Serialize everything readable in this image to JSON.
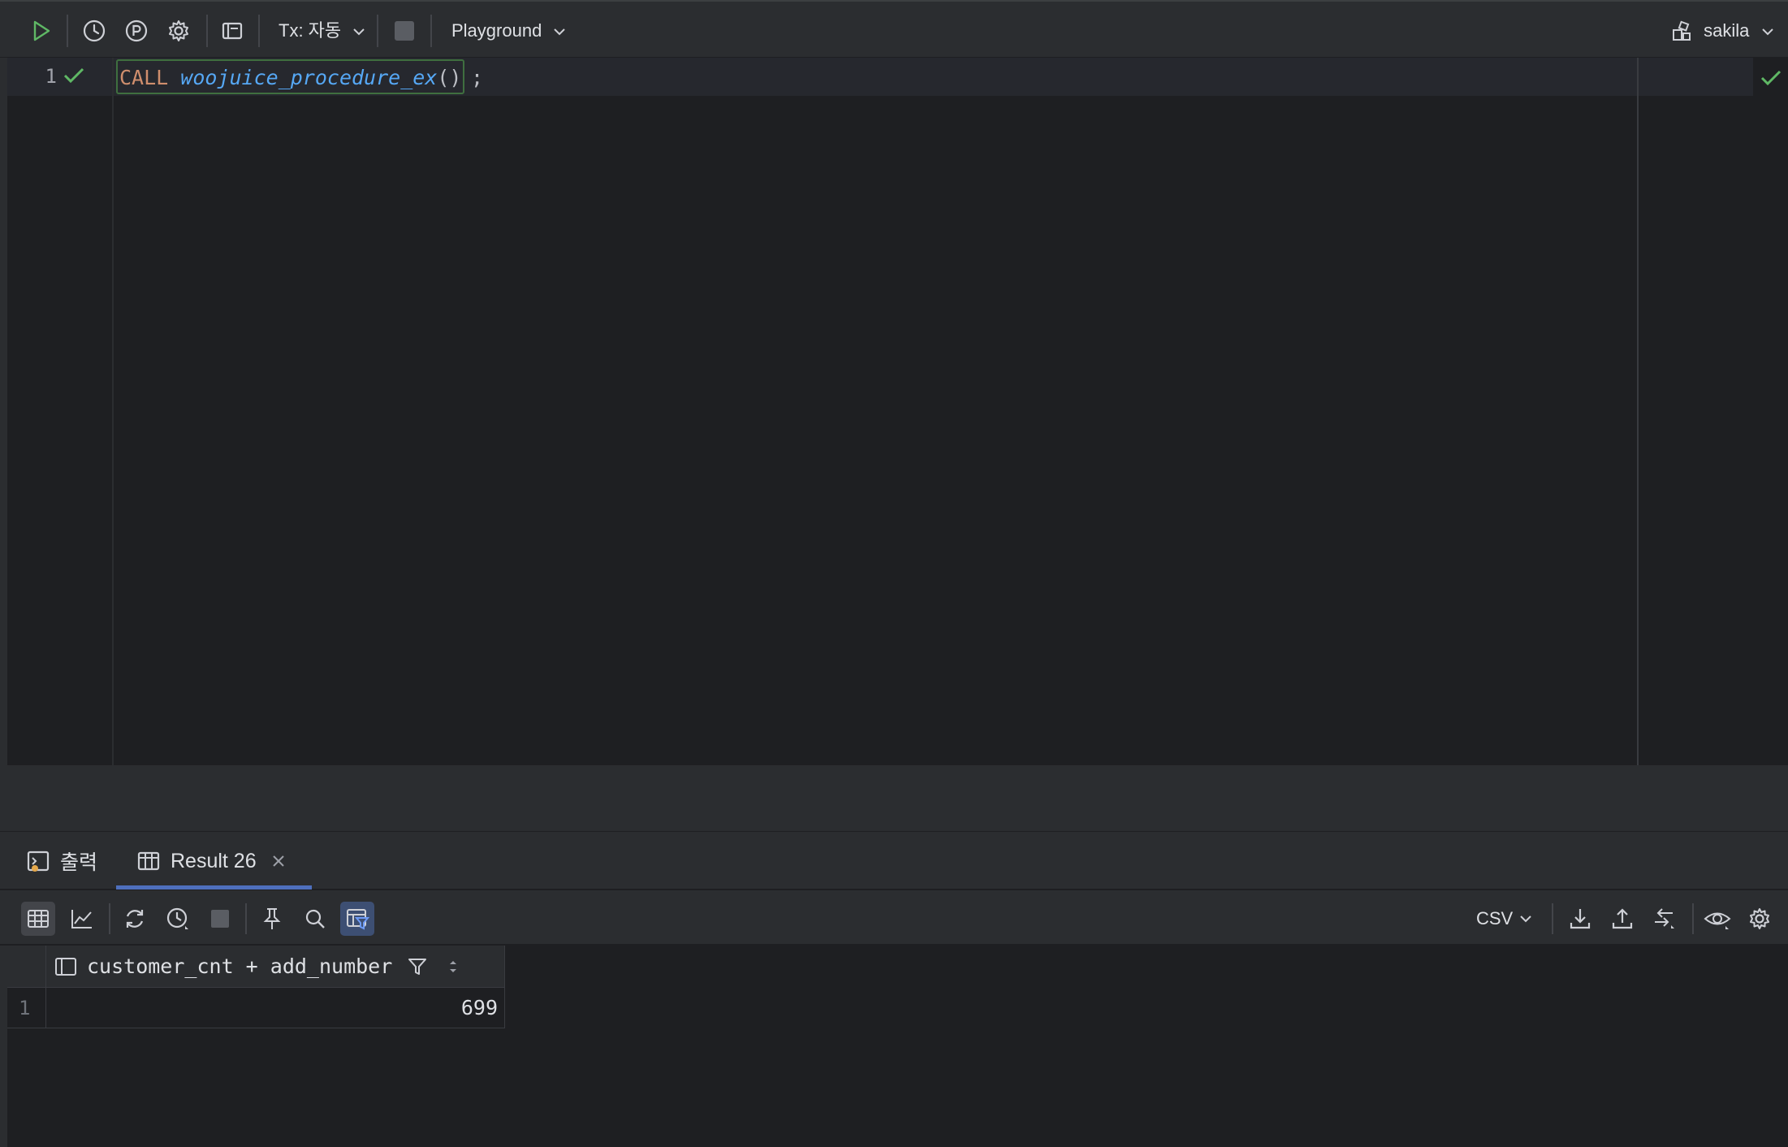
{
  "toolbar": {
    "tx_label": "Tx: 자동",
    "playground_label": "Playground",
    "schema_label": "sakila"
  },
  "editor": {
    "line_number": "1",
    "code": {
      "keyword": "CALL",
      "procedure": "woojuice_procedure_ex",
      "parens": "()",
      "semicolon": ";"
    }
  },
  "results": {
    "tabs": [
      {
        "label": "출력",
        "icon": "console-icon"
      },
      {
        "label": "Result 26",
        "icon": "table-icon",
        "selected": true
      }
    ],
    "format_label": "CSV",
    "columns": [
      "customer_cnt + add_number"
    ],
    "rows": [
      {
        "row_number": "1",
        "values": [
          "699"
        ]
      }
    ]
  },
  "colors": {
    "keyword": "#cf8e6d",
    "function": "#56a8f5",
    "success": "#5fb865",
    "accent": "#4e6fbd"
  }
}
